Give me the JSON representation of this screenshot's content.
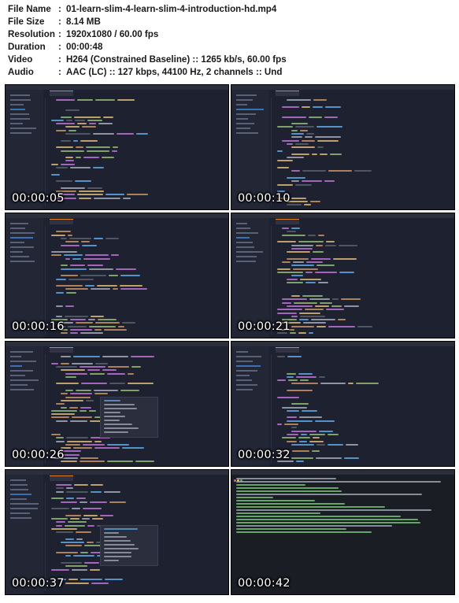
{
  "file_info": [
    {
      "key": "File Name",
      "value": "01-learn-slim-4-learn-slim-4-introduction-hd.mp4"
    },
    {
      "key": "File Size",
      "value": "8.14 MB"
    },
    {
      "key": "Resolution",
      "value": "1920x1080 / 60.00 fps"
    },
    {
      "key": "Duration",
      "value": "00:00:48"
    },
    {
      "key": "Video",
      "value": "H264 (Constrained Baseline) :: 1265 kb/s, 60.00 fps"
    },
    {
      "key": "Audio",
      "value": "AAC (LC) :: 127 kbps, 44100 Hz, 2 channels :: Und"
    }
  ],
  "separator": ":",
  "thumbnails": [
    {
      "timestamp": "00:00:05",
      "kind": "editor"
    },
    {
      "timestamp": "00:00:10",
      "kind": "editor"
    },
    {
      "timestamp": "00:00:16",
      "kind": "editor"
    },
    {
      "timestamp": "00:00:21",
      "kind": "editor-html"
    },
    {
      "timestamp": "00:00:26",
      "kind": "editor-autocomplete"
    },
    {
      "timestamp": "00:00:32",
      "kind": "editor"
    },
    {
      "timestamp": "00:00:37",
      "kind": "editor-autocomplete"
    },
    {
      "timestamp": "00:00:42",
      "kind": "terminal"
    }
  ],
  "colors": {
    "editor_bg": "#1e2130",
    "sidebar_bg": "#232634",
    "keyword": "#c678dd",
    "string": "#98c379",
    "function": "#61afef",
    "variable": "#e5c07b",
    "plain": "#abb2bf",
    "comment": "#5c6370",
    "orange": "#d19a66",
    "terminal_text": "#7fd37f"
  }
}
